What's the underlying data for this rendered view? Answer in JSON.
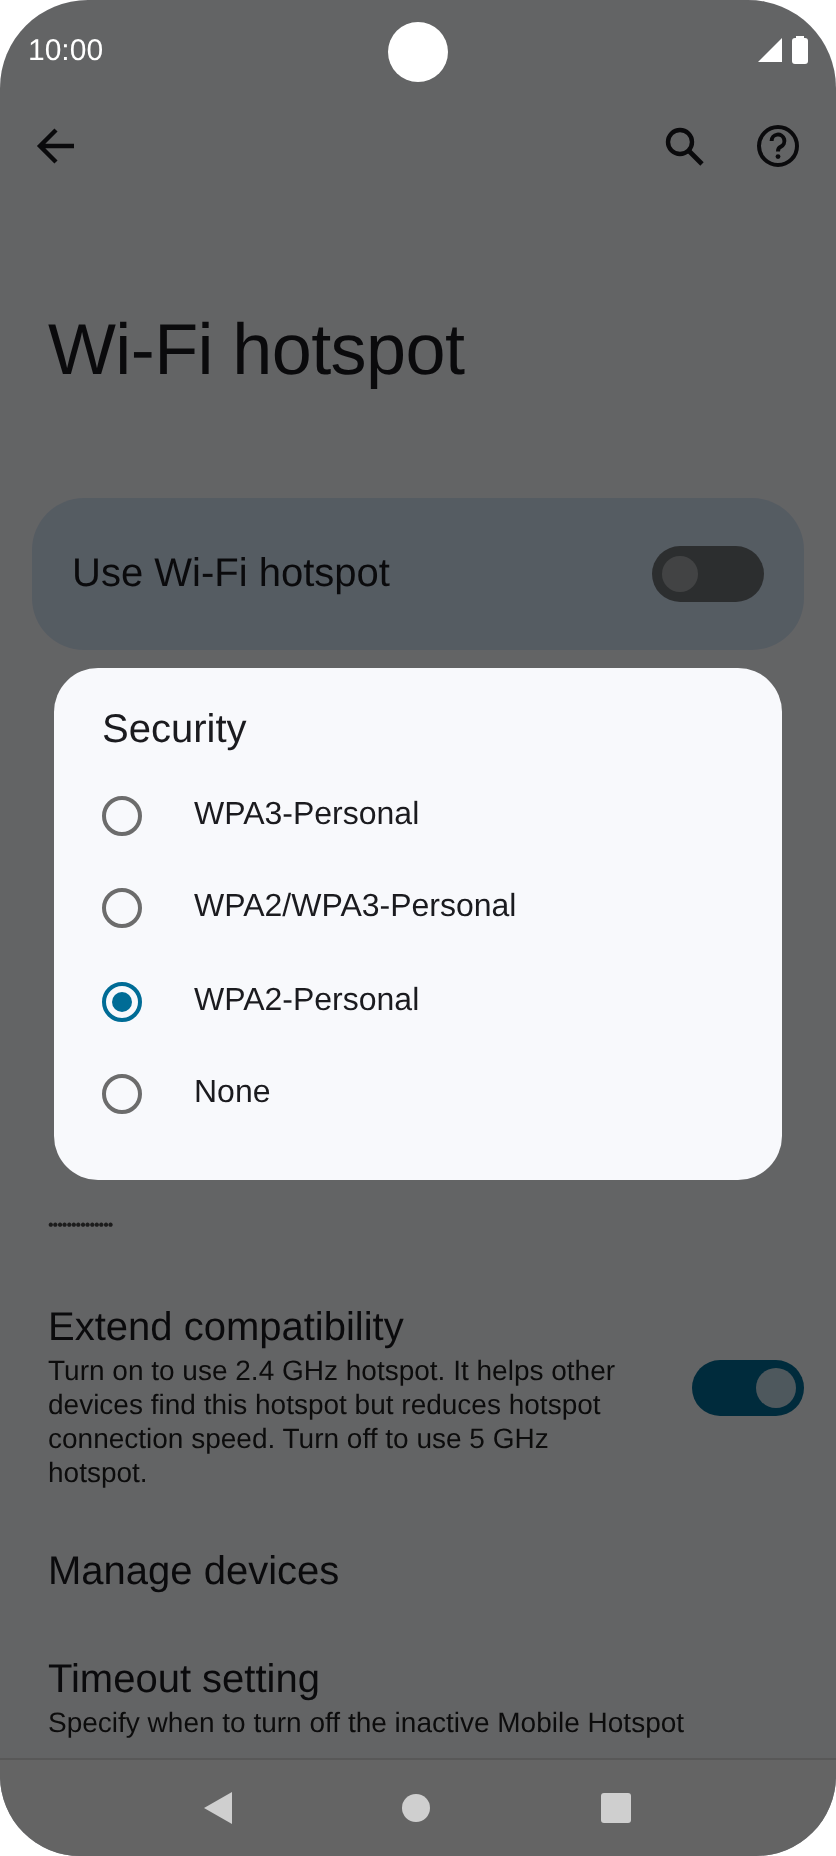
{
  "status_bar": {
    "time": "10:00"
  },
  "page": {
    "title": "Wi-Fi hotspot"
  },
  "main_switch": {
    "label": "Use Wi-Fi hotspot",
    "on": false
  },
  "password": {
    "value": "••••••••••••••"
  },
  "settings": [
    {
      "kind": "toggle",
      "title": "Extend compatibility",
      "description": "Turn on to use 2.4 GHz hotspot. It helps other devices find this hotspot but reduces hotspot connection speed. Turn off to use 5 GHz hotspot.",
      "on": true
    },
    {
      "kind": "link",
      "title": "Manage devices"
    },
    {
      "kind": "link",
      "title": "Timeout setting",
      "description": "Specify when to turn off the inactive Mobile Hotspot"
    }
  ],
  "dialog": {
    "title": "Security",
    "options": [
      {
        "label": "WPA3-Personal",
        "selected": false
      },
      {
        "label": "WPA2/WPA3-Personal",
        "selected": false
      },
      {
        "label": "WPA2-Personal",
        "selected": true
      },
      {
        "label": "None",
        "selected": false
      }
    ]
  }
}
